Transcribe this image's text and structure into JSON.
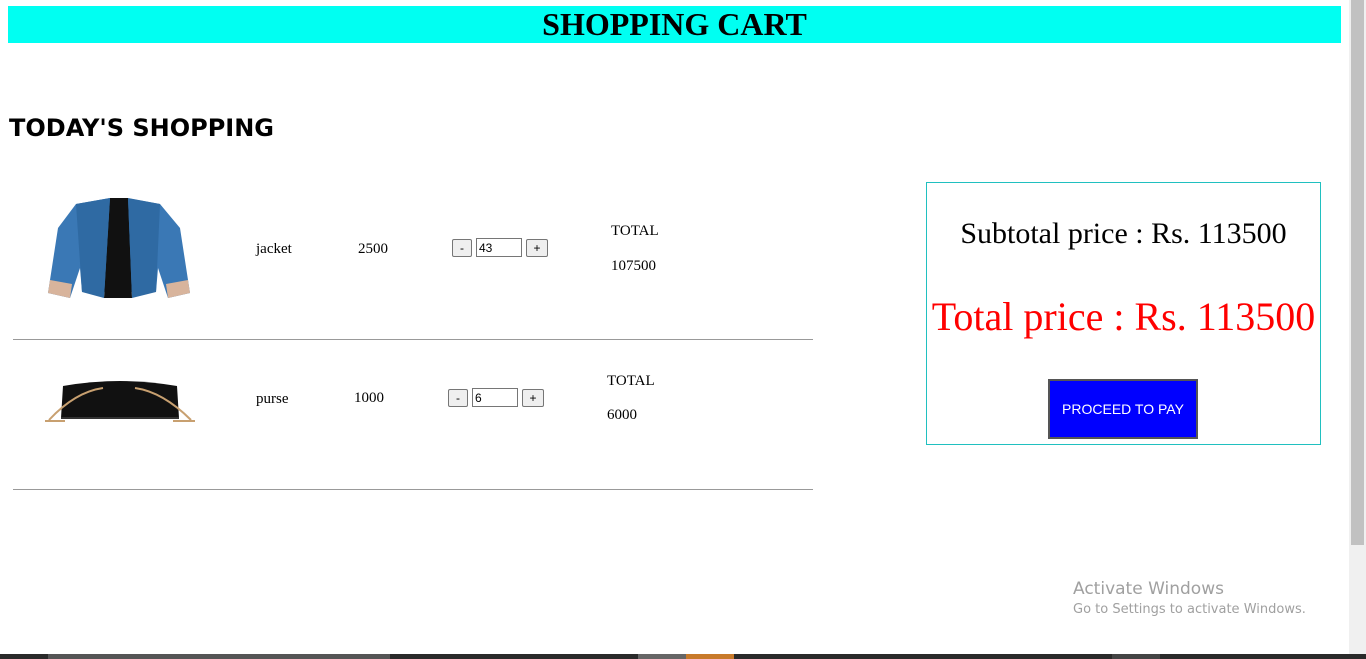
{
  "header": {
    "title": "SHOPPING CART"
  },
  "section": {
    "title": "TODAY'S SHOPPING"
  },
  "cart": {
    "items": [
      {
        "name": "jacket",
        "price": "2500",
        "quantity": "43",
        "total_label": "TOTAL",
        "total": "107500",
        "image": "jacket-image"
      },
      {
        "name": "purse",
        "price": "1000",
        "quantity": "6",
        "total_label": "TOTAL",
        "total": "6000",
        "image": "purse-image"
      }
    ],
    "minus_label": "-",
    "plus_label": "+"
  },
  "summary": {
    "subtotal": "Subtotal price : Rs. 113500",
    "total": "Total price : Rs. 113500",
    "pay_button": "PROCEED TO PAY"
  },
  "watermark": {
    "line1": "Activate Windows",
    "line2": "Go to Settings to activate Windows."
  },
  "colors": {
    "header_bg": "#00fff2",
    "total_price": "#ff0000",
    "pay_button": "#0000ff"
  }
}
